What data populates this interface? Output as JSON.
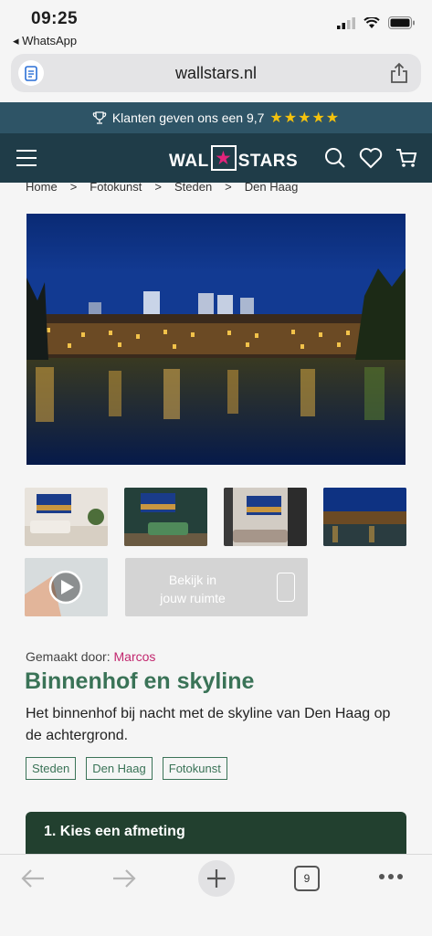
{
  "status": {
    "time": "09:25",
    "back_app": "◂ WhatsApp"
  },
  "browser": {
    "url": "wallstars.nl",
    "tab_count": "9"
  },
  "promo": {
    "text": "Klanten geven ons een 9,7",
    "stars": "★★★★★"
  },
  "header": {
    "logo_left": "WAL",
    "logo_right": "STARS"
  },
  "breadcrumb": [
    "Home",
    ">",
    "Fotokunst",
    ">",
    "Steden",
    ">",
    "Den Haag"
  ],
  "ar_button": {
    "line1": "Bekijk in",
    "line2": "jouw ruimte"
  },
  "product": {
    "maker_label": "Gemaakt door:",
    "maker_name": "Marcos",
    "title": "Binnenhof en skyline",
    "description": "Het binnenhof bij nacht met de skyline van Den Haag op de achtergrond.",
    "tags": [
      "Steden",
      "Den Haag",
      "Fotokunst"
    ]
  },
  "size_section": {
    "title": "1. Kies een afmeting"
  },
  "colors": {
    "header": "#1f3c48",
    "promo": "#2e5466",
    "title_green": "#3a7357",
    "maker_pink": "#c2266e",
    "card": "#22402f"
  }
}
